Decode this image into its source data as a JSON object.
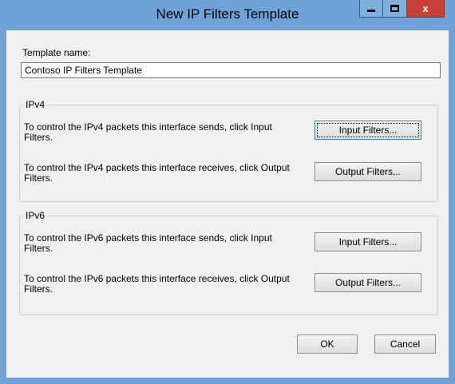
{
  "window": {
    "title": "New IP Filters Template",
    "controls": {
      "minimize": "minimize",
      "maximize": "maximize",
      "close": "x"
    }
  },
  "template": {
    "label": "Template name:",
    "value": "Contoso IP Filters Template"
  },
  "ipv4": {
    "legend": "IPv4",
    "send_text": "To control the IPv4 packets this interface sends, click Input Filters.",
    "receive_text": "To control the IPv4 packets this interface receives, click Output Filters.",
    "input_button": "Input Filters...",
    "output_button": "Output Filters..."
  },
  "ipv6": {
    "legend": "IPv6",
    "send_text": "To control the IPv6 packets this interface sends, click Input Filters.",
    "receive_text": "To control the IPv6 packets this interface receives, click Output Filters.",
    "input_button": "Input Filters...",
    "output_button": "Output Filters..."
  },
  "actions": {
    "ok": "OK",
    "cancel": "Cancel"
  },
  "colors": {
    "titlebar": "#6fa3d8",
    "close_button": "#c7413a",
    "dialog_background": "#f0f0f0"
  }
}
